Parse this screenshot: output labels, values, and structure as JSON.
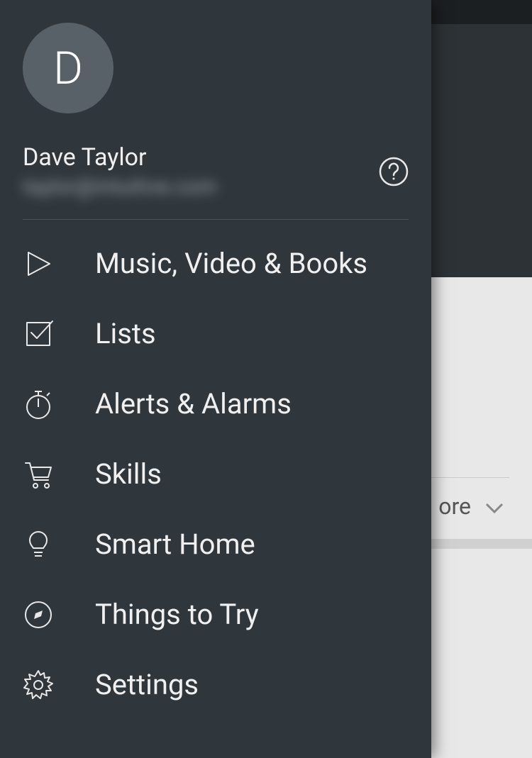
{
  "profile": {
    "avatar_initial": "D",
    "name": "Dave Taylor",
    "email_obscured": "taylor@intuitive.com"
  },
  "menu": {
    "items": [
      {
        "label": "Music, Video & Books",
        "icon": "play"
      },
      {
        "label": "Lists",
        "icon": "check"
      },
      {
        "label": "Alerts & Alarms",
        "icon": "stopwatch"
      },
      {
        "label": "Skills",
        "icon": "cart"
      },
      {
        "label": "Smart Home",
        "icon": "bulb"
      },
      {
        "label": "Things to Try",
        "icon": "compass"
      },
      {
        "label": "Settings",
        "icon": "gear"
      }
    ]
  },
  "background": {
    "more_label": "ore"
  }
}
